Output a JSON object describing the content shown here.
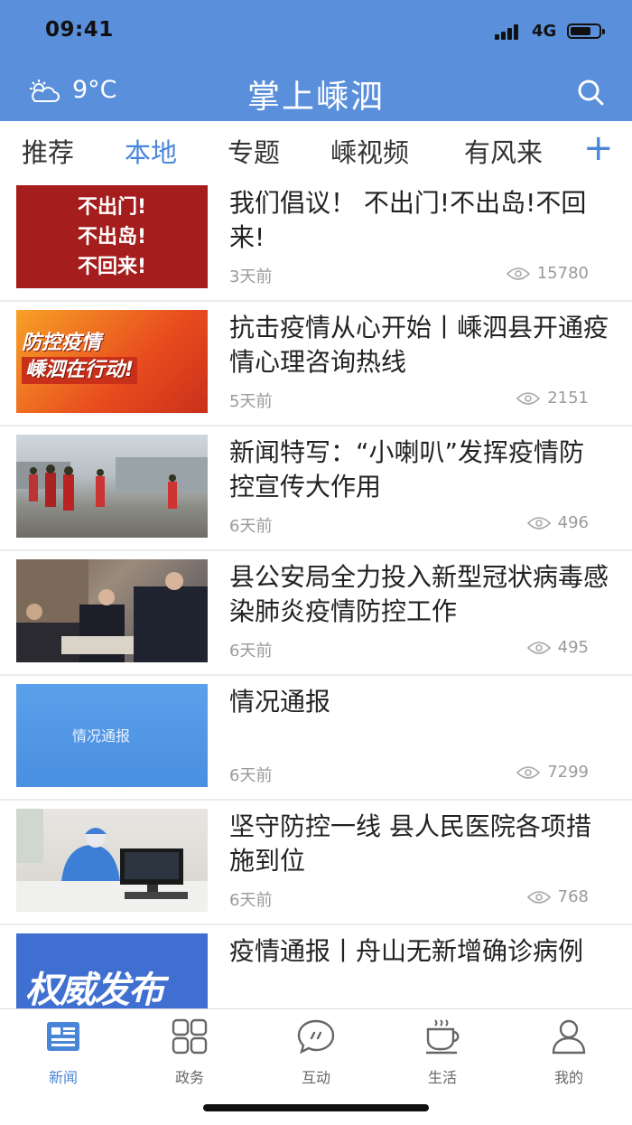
{
  "status_bar": {
    "time": "09:41",
    "network": "4G"
  },
  "header": {
    "temperature": "9°C",
    "title": "掌上嵊泗",
    "accent": "#5a8fdb"
  },
  "tabs": [
    {
      "label": "推荐",
      "active": false
    },
    {
      "label": "本地",
      "active": true
    },
    {
      "label": "专题",
      "active": false
    },
    {
      "label": "嵊视频",
      "active": false
    },
    {
      "label": "有风来",
      "active": false
    }
  ],
  "tab_add": "+",
  "news": [
    {
      "title": "我们倡议！ 不出门!不出岛!不回来!",
      "time": "3天前",
      "views": "15780",
      "thumb_lines": [
        "不出门!",
        "不出岛!",
        "不回来!"
      ]
    },
    {
      "title": "抗击疫情从心开始丨嵊泗县开通疫情心理咨询热线",
      "time": "5天前",
      "views": "2151",
      "thumb_lines": [
        "防控疫情",
        "嵊泗在行动!"
      ]
    },
    {
      "title": "新闻特写：“小喇叭”发挥疫情防控宣传大作用",
      "time": "6天前",
      "views": "496"
    },
    {
      "title": "县公安局全力投入新型冠状病毒感染肺炎疫情防控工作",
      "time": "6天前",
      "views": "495"
    },
    {
      "title": "情况通报",
      "time": "6天前",
      "views": "7299",
      "thumb_lines": [
        "情况通报"
      ]
    },
    {
      "title": "坚守防控一线 县人民医院各项措施到位",
      "time": "6天前",
      "views": "768"
    },
    {
      "title": "疫情通报丨舟山无新增确诊病例",
      "time": "",
      "views": "",
      "thumb_lines": [
        "权威发布"
      ]
    }
  ],
  "bottom_nav": [
    {
      "label": "新闻",
      "icon": "newspaper-icon",
      "active": true
    },
    {
      "label": "政务",
      "icon": "grid-icon",
      "active": false
    },
    {
      "label": "互动",
      "icon": "chat-icon",
      "active": false
    },
    {
      "label": "生活",
      "icon": "coffee-icon",
      "active": false
    },
    {
      "label": "我的",
      "icon": "user-icon",
      "active": false
    }
  ]
}
